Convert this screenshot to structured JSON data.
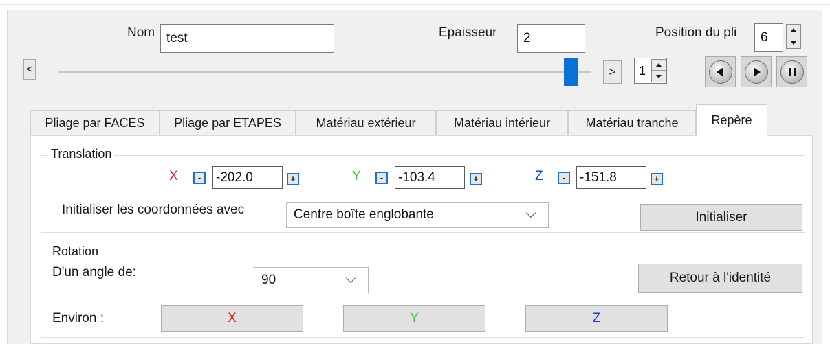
{
  "header": {
    "name_label": "Nom",
    "name_value": "test",
    "thickness_label": "Epaisseur",
    "thickness_value": "2",
    "fold_position_label": "Position du pli",
    "fold_position_value": "6"
  },
  "slider": {
    "prev_label": "<",
    "next_label": ">",
    "level": 1.0,
    "step_value": "1"
  },
  "media_controls": {
    "rewind": "rewind-icon",
    "play": "play-icon",
    "pause": "pause-icon"
  },
  "tabs": [
    {
      "label": "Pliage par FACES",
      "active": false
    },
    {
      "label": "Pliage par ETAPES",
      "active": false
    },
    {
      "label": "Matériau extérieur",
      "active": false
    },
    {
      "label": "Matériau intérieur",
      "active": false
    },
    {
      "label": "Matériau tranche",
      "active": false
    },
    {
      "label": "Repère",
      "active": true
    }
  ],
  "translation": {
    "title": "Translation",
    "x": {
      "label": "X",
      "value": "-202.0",
      "color": "#e02020"
    },
    "y": {
      "label": "Y",
      "value": "-103.4",
      "color": "#3cc83c"
    },
    "z": {
      "label": "Z",
      "value": "-151.8",
      "color": "#1a3fd6"
    },
    "minus_label": "-",
    "plus_label": "+",
    "init_label": "Initialiser les coordonnées avec",
    "init_option": "Centre boîte englobante",
    "init_button": "Initialiser"
  },
  "rotation": {
    "title": "Rotation",
    "angle_label": "D'un angle de:",
    "angle_value": "90",
    "reset_button": "Retour à l'identité",
    "around_label": "Environ :",
    "axis_x": "X",
    "axis_y": "Y",
    "axis_z": "Z"
  }
}
